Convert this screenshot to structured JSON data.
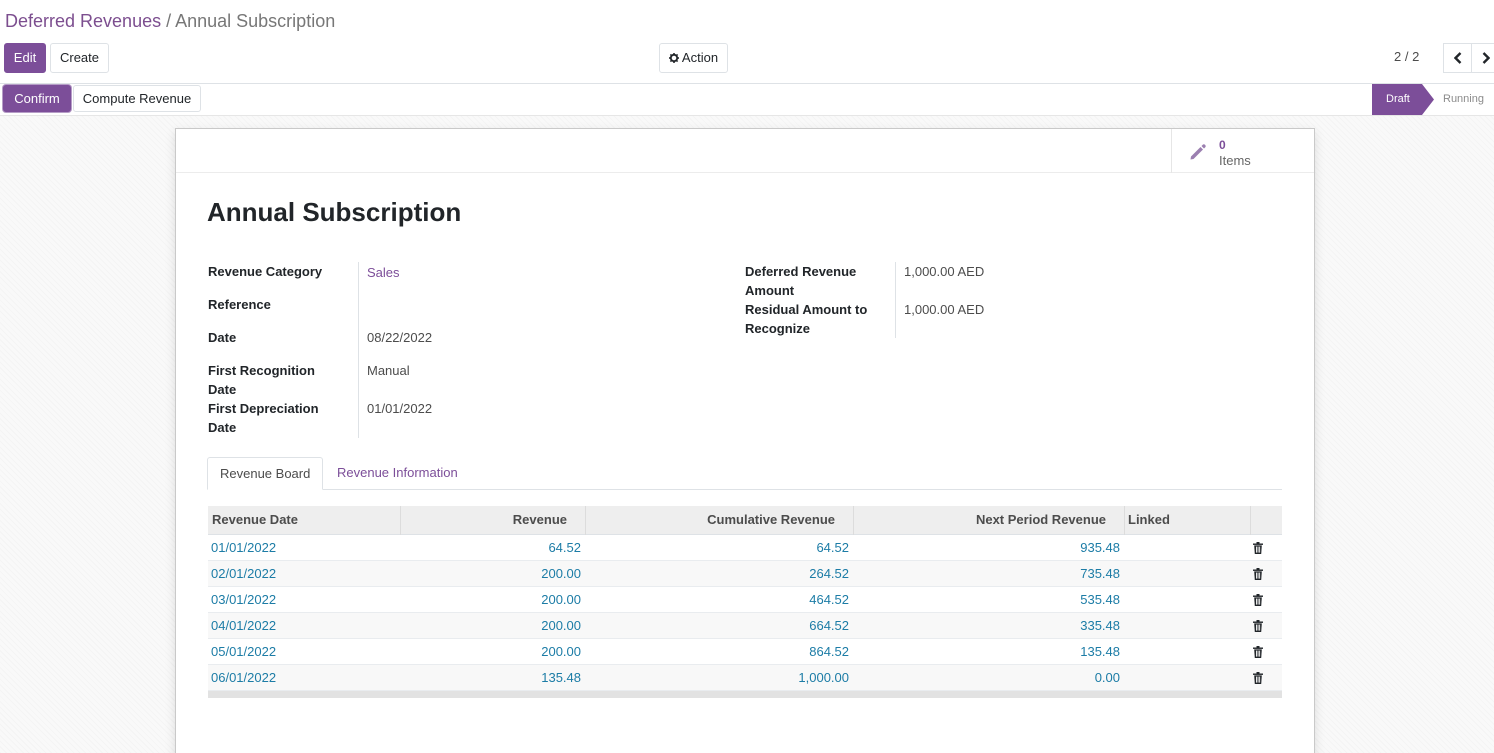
{
  "breadcrumb": {
    "parent": "Deferred Revenues",
    "separator": "/",
    "current": "Annual Subscription"
  },
  "toolbar": {
    "edit_label": "Edit",
    "create_label": "Create",
    "action_label": "Action"
  },
  "pager": {
    "value": "2 / 2"
  },
  "actions": {
    "confirm_label": "Confirm",
    "compute_label": "Compute Revenue"
  },
  "statusbar": {
    "draft": "Draft",
    "running": "Running"
  },
  "stat_button": {
    "value": "0",
    "label": "Items"
  },
  "record": {
    "title": "Annual Subscription",
    "left_fields": {
      "category_label": "Revenue Category",
      "category_value": "Sales",
      "reference_label": "Reference",
      "reference_value": "",
      "date_label": "Date",
      "date_value": "08/22/2022",
      "first_recognition_label": "First Recognition Date",
      "first_recognition_value": "Manual",
      "first_depreciation_label": "First Depreciation Date",
      "first_depreciation_value": "01/01/2022"
    },
    "right_fields": {
      "deferred_amount_label": "Deferred Revenue Amount",
      "deferred_amount_value": "1,000.00 AED",
      "residual_label": "Residual Amount to Recognize",
      "residual_value": "1,000.00 AED"
    }
  },
  "tabs": {
    "board": "Revenue Board",
    "info": "Revenue Information"
  },
  "board": {
    "columns": {
      "date": "Revenue Date",
      "revenue": "Revenue",
      "cumulative": "Cumulative Revenue",
      "next": "Next Period Revenue",
      "linked": "Linked"
    },
    "rows": [
      {
        "date": "01/01/2022",
        "revenue": "64.52",
        "cumulative": "64.52",
        "next": "935.48"
      },
      {
        "date": "02/01/2022",
        "revenue": "200.00",
        "cumulative": "264.52",
        "next": "735.48"
      },
      {
        "date": "03/01/2022",
        "revenue": "200.00",
        "cumulative": "464.52",
        "next": "535.48"
      },
      {
        "date": "04/01/2022",
        "revenue": "200.00",
        "cumulative": "664.52",
        "next": "335.48"
      },
      {
        "date": "05/01/2022",
        "revenue": "200.00",
        "cumulative": "864.52",
        "next": "135.48"
      },
      {
        "date": "06/01/2022",
        "revenue": "135.48",
        "cumulative": "1,000.00",
        "next": "0.00"
      }
    ]
  },
  "icons": {
    "action": "gear-icon",
    "stat": "pencil-icon",
    "row_delete": "trash-icon",
    "prev": "chevron-left-icon",
    "next": "chevron-right-icon"
  },
  "colors": {
    "brand": "#7c4e99",
    "link": "#1c7ca6"
  }
}
